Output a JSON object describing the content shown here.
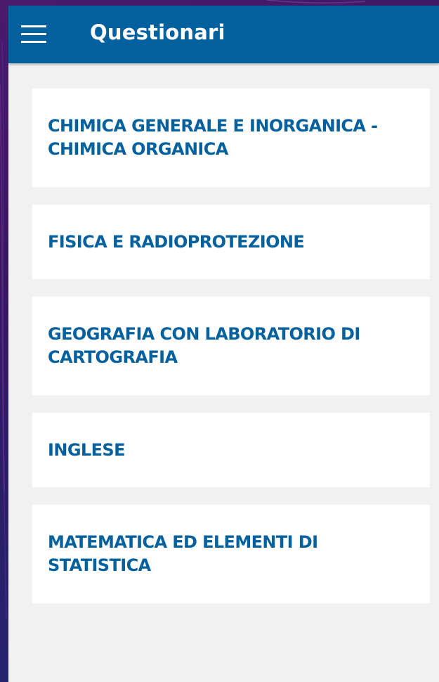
{
  "app_bar": {
    "title": "Questionari",
    "menu_icon": "hamburger-menu-icon",
    "background_color": "#04619e"
  },
  "courses": [
    {
      "title": "CHIMICA GENERALE E INORGANICA - CHIMICA ORGANICA"
    },
    {
      "title": "FISICA E RADIOPROTEZIONE"
    },
    {
      "title": "GEOGRAFIA CON LABORATORIO DI CARTOGRAFIA"
    },
    {
      "title": "INGLESE"
    },
    {
      "title": "MATEMATICA ED ELEMENTI DI STATISTICA"
    }
  ],
  "colors": {
    "accent": "#04619e",
    "card_background": "#ffffff",
    "content_background": "#f1f1f1"
  }
}
